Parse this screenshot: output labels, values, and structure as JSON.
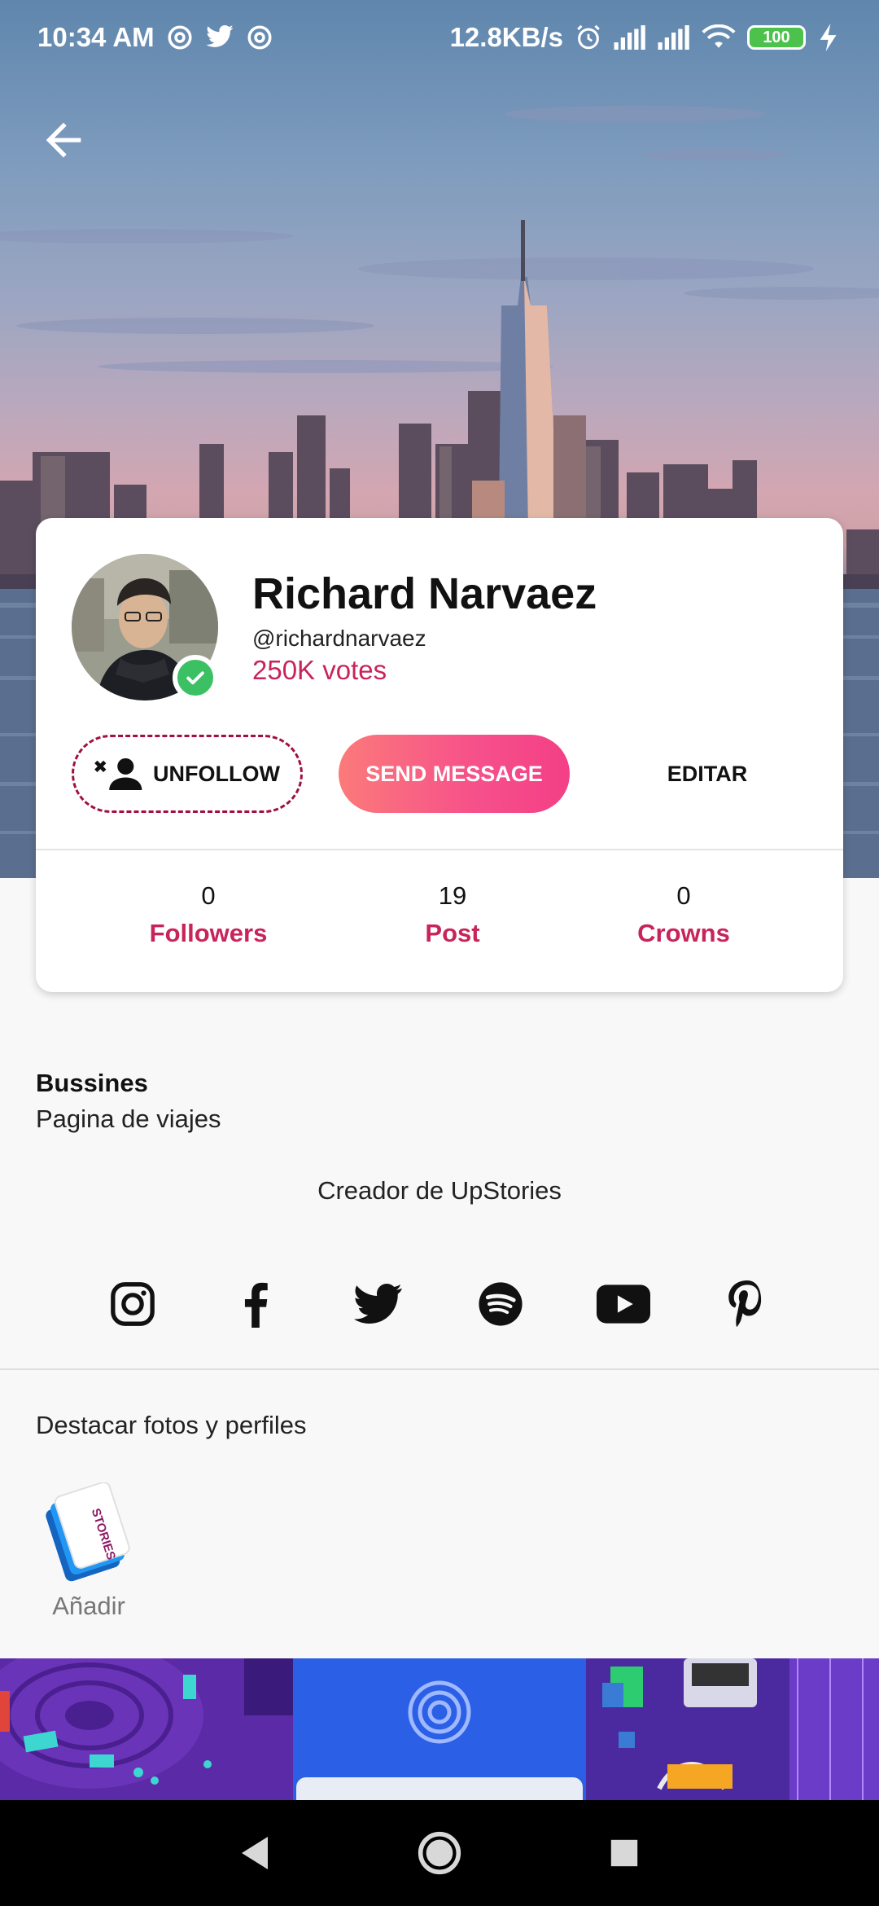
{
  "status_bar": {
    "time": "10:34 AM",
    "network_speed": "12.8KB/s",
    "battery": "100"
  },
  "header": {
    "back_icon": "arrow-left-icon"
  },
  "profile": {
    "name": "Richard Narvaez",
    "handle": "@richardnarvaez",
    "votes": "250K votes",
    "verified_icon": "check-circle-icon"
  },
  "actions": {
    "unfollow_label": "UNFOLLOW",
    "send_message_label": "SEND MESSAGE",
    "edit_label": "EDITAR"
  },
  "stats": [
    {
      "value": "0",
      "label": "Followers"
    },
    {
      "value": "19",
      "label": "Post"
    },
    {
      "value": "0",
      "label": "Crowns"
    }
  ],
  "about": {
    "category": "Bussines",
    "bio": "Pagina de viajes",
    "creator_line": "Creador de UpStories"
  },
  "social_links": [
    "instagram-icon",
    "facebook-icon",
    "twitter-icon",
    "spotify-icon",
    "youtube-icon",
    "pinterest-icon"
  ],
  "highlights": {
    "title": "Destacar fotos y perfiles",
    "add_label": "Añadir",
    "add_badge_text": "STORIES"
  },
  "colors": {
    "accent": "#c8245a",
    "verified": "#3cc064",
    "message_gradient_start": "#fb7a7a",
    "message_gradient_end": "#f43f86"
  }
}
